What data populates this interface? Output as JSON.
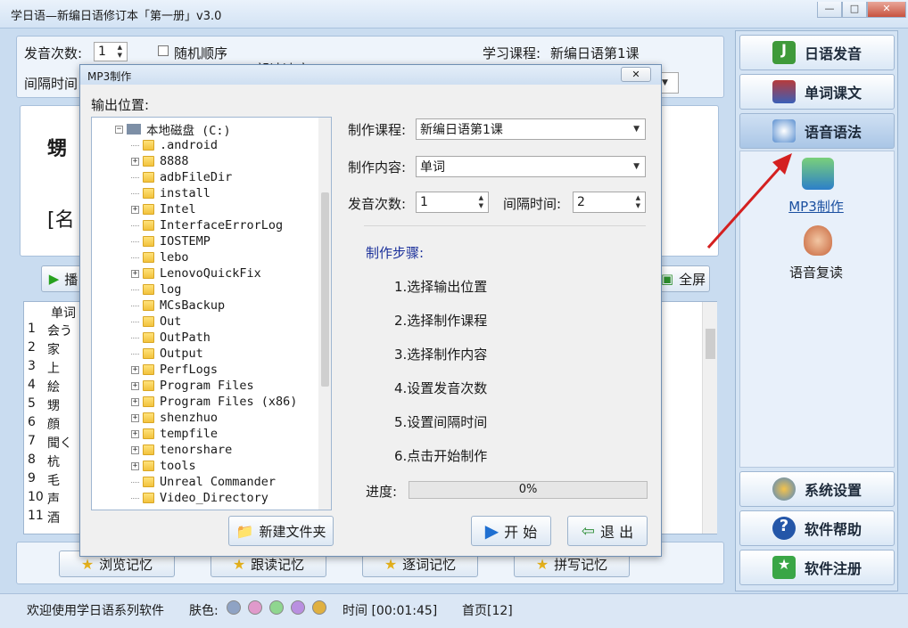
{
  "window": {
    "title": "学日语—新编日语修订本「第一册」v3.0",
    "min": "—",
    "max": "□",
    "close": "✕"
  },
  "top": {
    "repeat_label": "发音次数:",
    "repeat_value": "1",
    "random_label": "随机顺序",
    "interval_label": "间隔时间",
    "speed_label": "朗读速度",
    "course_label": "学习课程:",
    "course_value": "新编日语第1课"
  },
  "word_display": {
    "word": "甥",
    "pos": "[名"
  },
  "toolbar": {
    "play_label": "播",
    "fullscreen_label": "全屏"
  },
  "word_list": {
    "header": "单词",
    "rows": [
      {
        "n": "1",
        "w": "会う"
      },
      {
        "n": "2",
        "w": "家"
      },
      {
        "n": "3",
        "w": "上"
      },
      {
        "n": "4",
        "w": "絵"
      },
      {
        "n": "5",
        "w": "甥"
      },
      {
        "n": "6",
        "w": "顔"
      },
      {
        "n": "7",
        "w": "聞く"
      },
      {
        "n": "8",
        "w": "杭"
      },
      {
        "n": "9",
        "w": "毛"
      },
      {
        "n": "10",
        "w": "声"
      },
      {
        "n": "11",
        "w": "酒"
      }
    ]
  },
  "bottom_buttons": [
    "浏览记忆",
    "跟读记忆",
    "逐词记忆",
    "拼写记忆"
  ],
  "sidebar": {
    "nav": [
      "日语发音",
      "单词课文",
      "语音语法"
    ],
    "sub": [
      "MP3制作",
      "语音复读"
    ],
    "bottom": [
      "系统设置",
      "软件帮助",
      "软件注册"
    ]
  },
  "dialog": {
    "title": "MP3制作",
    "close": "✕",
    "output_label": "输出位置:",
    "tree_root": "本地磁盘 (C:)",
    "folders": [
      {
        "name": ".android",
        "exp": false
      },
      {
        "name": "8888",
        "exp": true
      },
      {
        "name": "adbFileDir",
        "exp": false
      },
      {
        "name": "install",
        "exp": false
      },
      {
        "name": "Intel",
        "exp": true
      },
      {
        "name": "InterfaceErrorLog",
        "exp": false
      },
      {
        "name": "IOSTEMP",
        "exp": false
      },
      {
        "name": "lebo",
        "exp": false
      },
      {
        "name": "LenovoQuickFix",
        "exp": true
      },
      {
        "name": "log",
        "exp": false
      },
      {
        "name": "MCsBackup",
        "exp": false
      },
      {
        "name": "Out",
        "exp": false
      },
      {
        "name": "OutPath",
        "exp": false
      },
      {
        "name": "Output",
        "exp": false
      },
      {
        "name": "PerfLogs",
        "exp": true
      },
      {
        "name": "Program Files",
        "exp": true
      },
      {
        "name": "Program Files (x86)",
        "exp": true
      },
      {
        "name": "shenzhuo",
        "exp": true
      },
      {
        "name": "tempfile",
        "exp": true
      },
      {
        "name": "tenorshare",
        "exp": true
      },
      {
        "name": "tools",
        "exp": true
      },
      {
        "name": "Unreal Commander",
        "exp": false
      },
      {
        "name": "Video_Directory",
        "exp": false
      }
    ],
    "new_folder": "新建文件夹",
    "course_label": "制作课程:",
    "course_value": "新编日语第1课",
    "content_label": "制作内容:",
    "content_value": "单词",
    "repeat_label": "发音次数:",
    "repeat_value": "1",
    "interval_label": "间隔时间:",
    "interval_value": "2",
    "steps_title": "制作步骤:",
    "steps": [
      "1.选择输出位置",
      "2.选择制作课程",
      "3.选择制作内容",
      "4.设置发音次数",
      "5.设置间隔时间",
      "6.点击开始制作"
    ],
    "progress_label": "进度:",
    "progress_text": "0%",
    "progress": 0,
    "start": "开 始",
    "exit": "退 出"
  },
  "status": {
    "welcome": "欢迎使用学日语系列软件",
    "skin_label": "肤色:",
    "time": "时间 [00:01:45]",
    "page": "首页[12]"
  },
  "colors": {
    "skins": [
      "#8fa3c4",
      "#e09acb",
      "#8fd68f",
      "#b98fe0",
      "#e0b040"
    ],
    "accent": "#1a4fa0",
    "steps_title": "#1a2f9a"
  }
}
